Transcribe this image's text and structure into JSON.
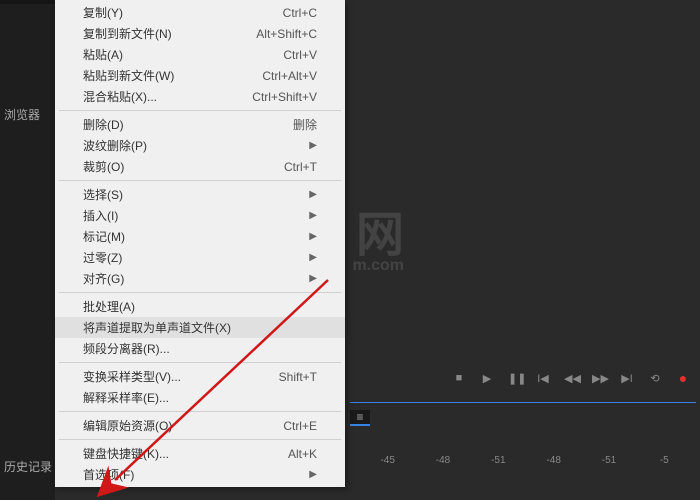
{
  "sidebar": {
    "browser_label": "浏览器",
    "history_label": "历史记录"
  },
  "watermark": {
    "main": "GX/ 网",
    "sub": "m.com"
  },
  "menu": {
    "items": [
      {
        "label": "复制(Y)",
        "shortcut": "Ctrl+C",
        "submenu": false
      },
      {
        "label": "复制到新文件(N)",
        "shortcut": "Alt+Shift+C",
        "submenu": false
      },
      {
        "label": "粘贴(A)",
        "shortcut": "Ctrl+V",
        "submenu": false
      },
      {
        "label": "粘贴到新文件(W)",
        "shortcut": "Ctrl+Alt+V",
        "submenu": false
      },
      {
        "label": "混合粘贴(X)...",
        "shortcut": "Ctrl+Shift+V",
        "submenu": false
      },
      {
        "type": "separator"
      },
      {
        "label": "删除(D)",
        "shortcut": "删除",
        "submenu": false
      },
      {
        "label": "波纹删除(P)",
        "shortcut": "",
        "submenu": true
      },
      {
        "label": "裁剪(O)",
        "shortcut": "Ctrl+T",
        "submenu": false
      },
      {
        "type": "separator"
      },
      {
        "label": "选择(S)",
        "shortcut": "",
        "submenu": true
      },
      {
        "label": "插入(I)",
        "shortcut": "",
        "submenu": true
      },
      {
        "label": "标记(M)",
        "shortcut": "",
        "submenu": true
      },
      {
        "label": "过零(Z)",
        "shortcut": "",
        "submenu": true
      },
      {
        "label": "对齐(G)",
        "shortcut": "",
        "submenu": true
      },
      {
        "type": "separator"
      },
      {
        "label": "批处理(A)",
        "shortcut": "",
        "submenu": false
      },
      {
        "label": "将声道提取为单声道文件(X)",
        "shortcut": "",
        "submenu": false,
        "highlighted": true
      },
      {
        "label": "频段分离器(R)...",
        "shortcut": "",
        "submenu": false
      },
      {
        "type": "separator"
      },
      {
        "label": "变换采样类型(V)...",
        "shortcut": "Shift+T",
        "submenu": false
      },
      {
        "label": "解释采样率(E)...",
        "shortcut": "",
        "submenu": false
      },
      {
        "type": "separator"
      },
      {
        "label": "编辑原始资源(O)",
        "shortcut": "Ctrl+E",
        "submenu": false
      },
      {
        "type": "separator"
      },
      {
        "label": "键盘快捷键(K)...",
        "shortcut": "Alt+K",
        "submenu": false
      },
      {
        "label": "首选项(F)",
        "shortcut": "",
        "submenu": true
      }
    ]
  },
  "timeline": {
    "ticks": [
      "-45",
      "-48",
      "-51",
      "-48",
      "-51",
      "-5"
    ]
  },
  "transport": {
    "icons": [
      "stop",
      "play",
      "pause",
      "skip-back",
      "rewind",
      "forward",
      "skip-fwd",
      "loop",
      "record"
    ]
  },
  "colors": {
    "accent": "#3584e4",
    "record": "#e03030"
  }
}
